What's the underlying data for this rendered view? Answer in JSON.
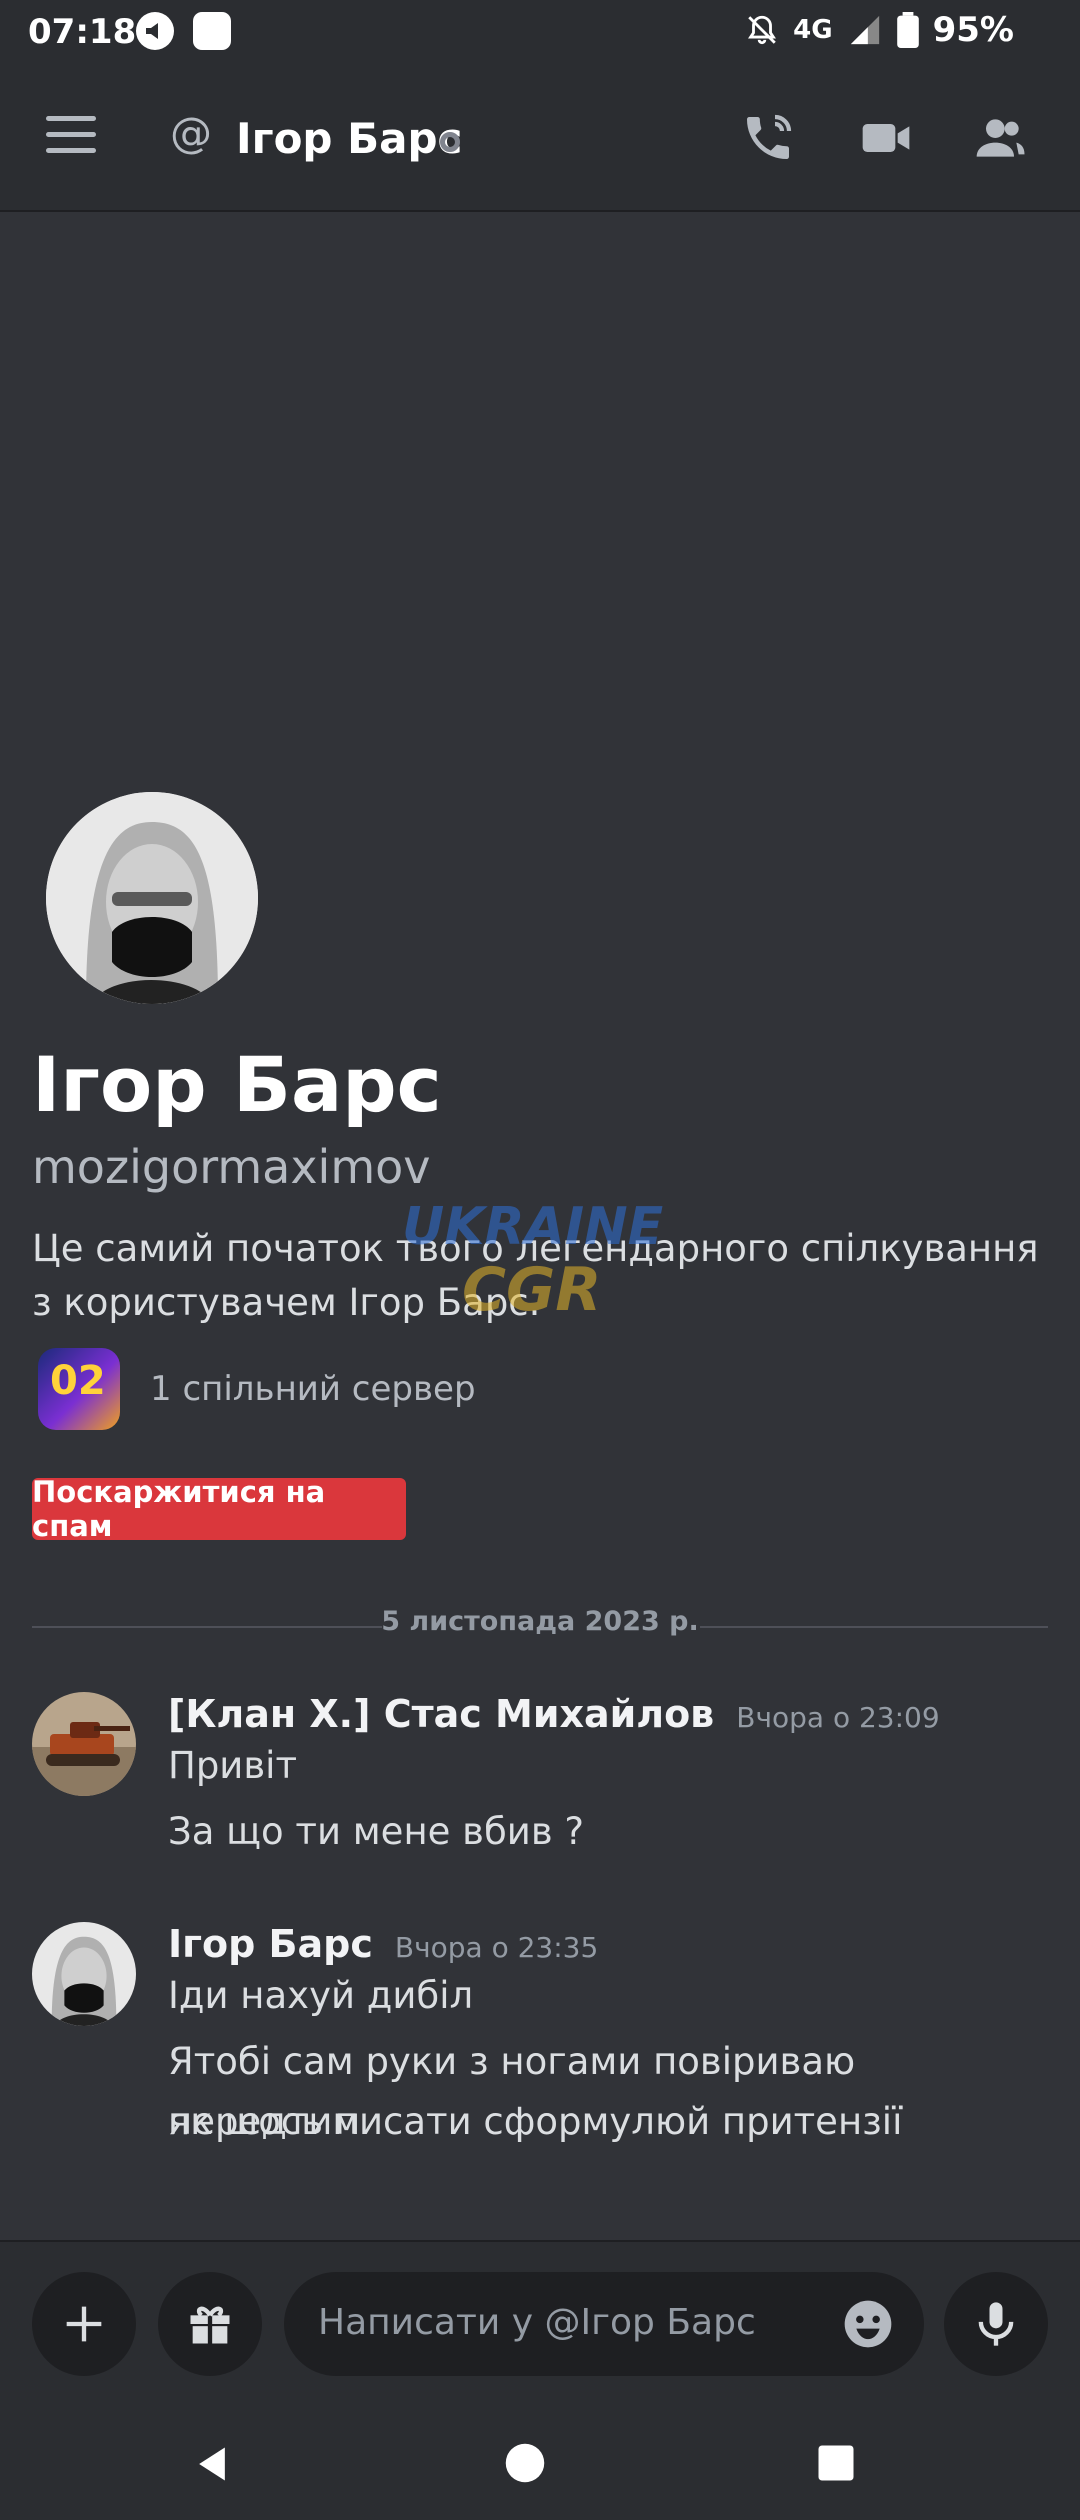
{
  "status_bar": {
    "time": "07:18",
    "network": "4G",
    "battery": "95%"
  },
  "header": {
    "at_symbol": "@",
    "title": "Ігор Барс",
    "icons": [
      "menu-icon",
      "voice-call-icon",
      "video-call-icon",
      "members-icon"
    ]
  },
  "profile": {
    "display_name": "Ігор Барс",
    "username": "mozigormaximov",
    "intro": "Це самий початок твого легендарного спілкування з користувачем Ігор Барс.",
    "mutual_servers": "1 спільний сервер",
    "server_icon_text": "02",
    "spam_button": "Поскаржитися на спам"
  },
  "date_divider": "5 листопада 2023 р.",
  "messages": [
    {
      "author": "[Клан Х.] Стас Михайлов",
      "time": "Вчора о 23:09",
      "lines": [
        "Привіт",
        "За що ти мене вбив ?"
      ]
    },
    {
      "author": "Ігор Барс",
      "time": "Вчора о 23:35",
      "lines": [
        "Іди нахуй дибіл",
        "Ятобі сам руки з ногами повіриваю передтим",
        "як шось писати сформулюй притензії"
      ]
    }
  ],
  "composer": {
    "placeholder": "Написати у @Ігор Барс"
  },
  "watermark": {
    "line1": "UKRAINE",
    "line2": "CGR"
  },
  "colors": {
    "background": "#313338",
    "header": "#2b2d31",
    "danger": "#da373c",
    "muted": "#949ba4"
  }
}
